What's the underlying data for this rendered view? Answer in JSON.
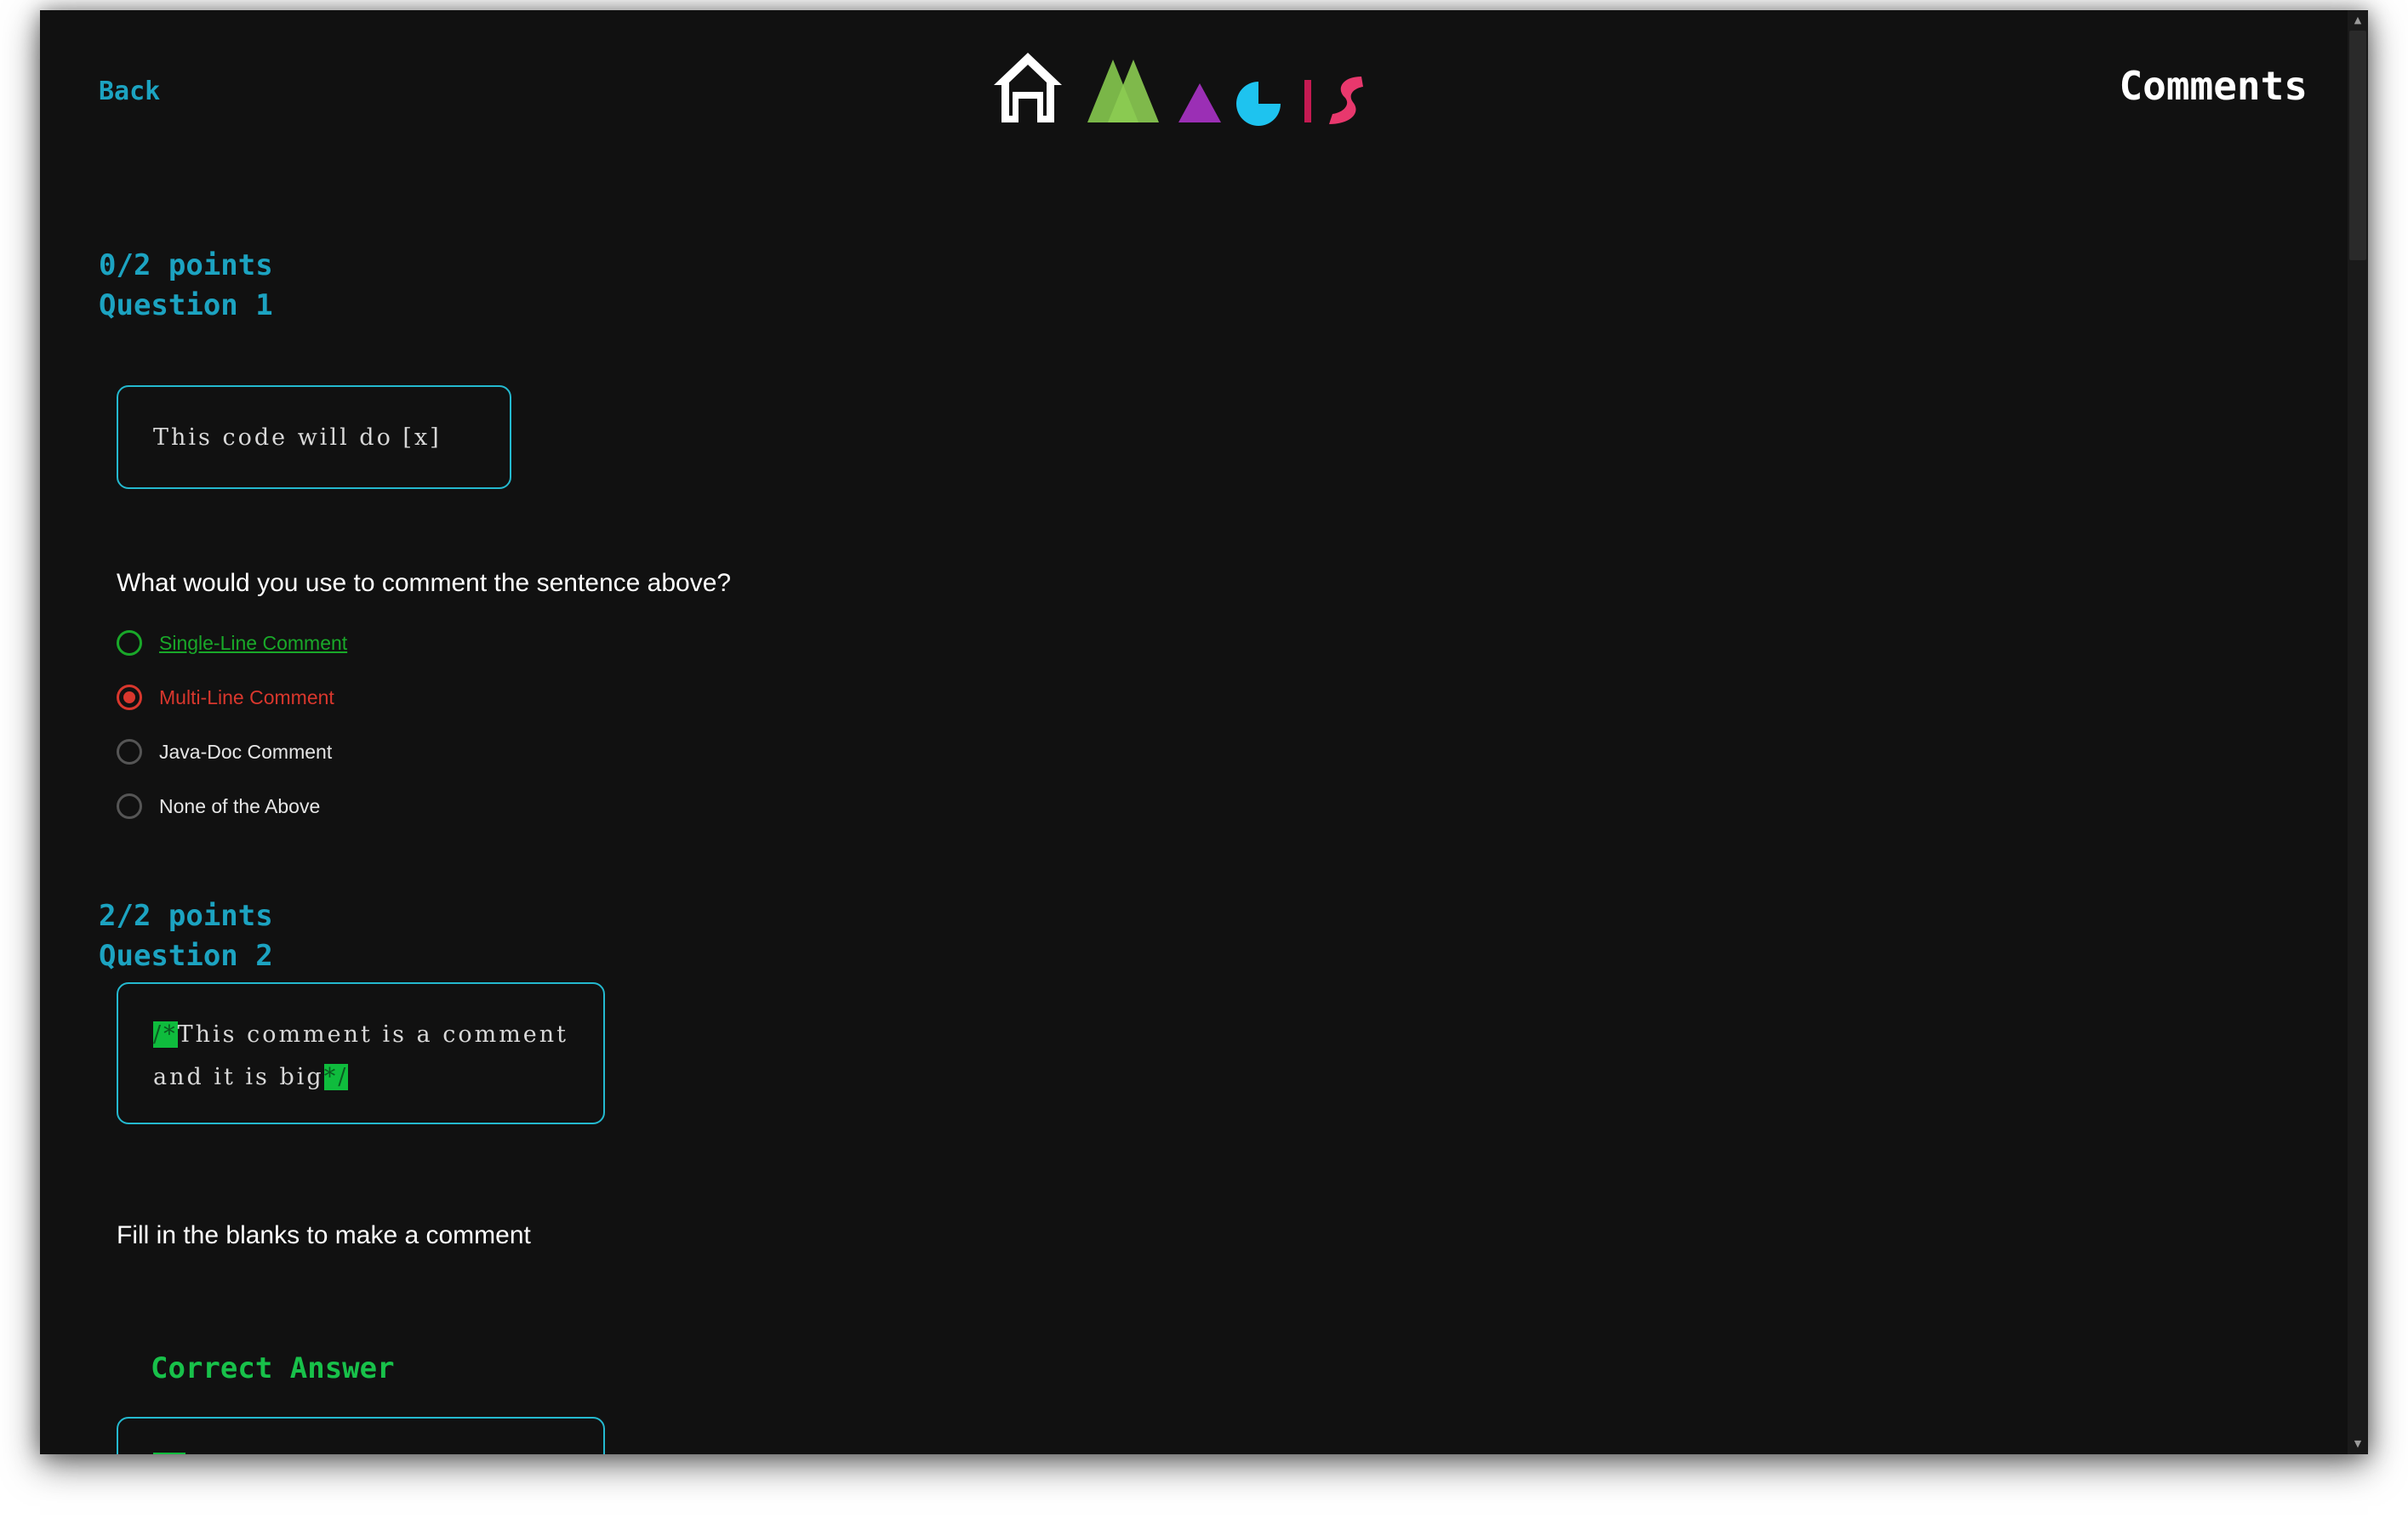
{
  "header": {
    "back_label": "Back",
    "page_title": "Comments"
  },
  "logo": {
    "letters": [
      "home",
      "M",
      "A",
      "G",
      "I",
      "S"
    ],
    "colors": {
      "home": "#ffffff",
      "m": "#7ab648",
      "a": "#9b2fb5",
      "g": "#1ec3ef",
      "i": "#c51a52",
      "s": "#e8386d"
    }
  },
  "questions": [
    {
      "points": "0/2 points",
      "title": "Question 1",
      "code_text": "This code will do [x]",
      "prompt": "What would you use to comment the sentence above?",
      "options": [
        {
          "label": "Single-Line Comment",
          "state": "correct"
        },
        {
          "label": "Multi-Line Comment",
          "state": "selected-wrong"
        },
        {
          "label": "Java-Doc Comment",
          "state": "neutral"
        },
        {
          "label": "None of the Above",
          "state": "neutral"
        }
      ]
    },
    {
      "points": "2/2 points",
      "title": "Question 2",
      "code_open": "/*",
      "code_text": "This comment is a comment and it is big",
      "code_close": "*/",
      "prompt": "Fill in the blanks to make a comment",
      "correct_answer_label": "Correct Answer"
    }
  ],
  "colors": {
    "accent": "#1ca3c1",
    "box_border": "#24b9cf",
    "correct": "#19a829",
    "wrong": "#d9372d",
    "highlight": "#0fbc3d",
    "background": "#111111"
  }
}
